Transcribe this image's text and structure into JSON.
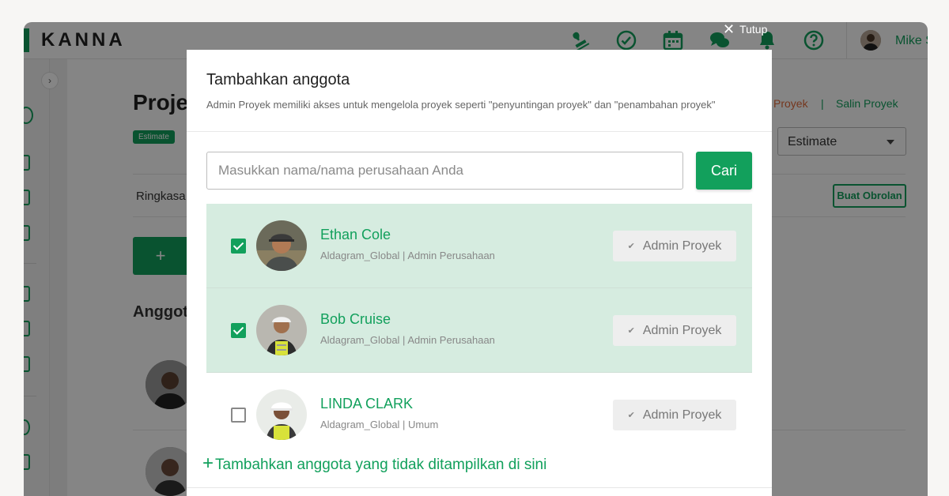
{
  "app": {
    "brand": "KANNA",
    "user_name": "Mike S"
  },
  "background": {
    "page_title": "Proje",
    "badge": "Estimate",
    "tab_label": "Ringkasa",
    "add_symbol": "+",
    "section_title": "Anggot",
    "link_project": "Proyek",
    "link_separator": "|",
    "link_copy": "Salin Proyek",
    "status_select_value": "Estimate",
    "chat_button": "Buat Obrolan"
  },
  "modal": {
    "close_label": "Tutup",
    "title": "Tambahkan anggota",
    "subtitle": "Admin Proyek memiliki akses untuk mengelola proyek seperti \"penyuntingan proyek\" dan \"penambahan proyek\"",
    "search": {
      "placeholder": "Masukkan nama/nama perusahaan Anda",
      "button": "Cari"
    },
    "members": [
      {
        "name": "Ethan Cole",
        "meta": "Aldagram_Global | Admin Perusahaan",
        "checked": true,
        "role": "Admin Proyek"
      },
      {
        "name": "Bob Cruise",
        "meta": "Aldagram_Global | Admin Perusahaan",
        "checked": true,
        "role": "Admin Proyek"
      },
      {
        "name": "LINDA CLARK",
        "meta": "Aldagram_Global | Umum",
        "checked": false,
        "role": "Admin Proyek"
      }
    ],
    "add_more_label": "Tambahkan anggota yang tidak ditampilkan di sini"
  },
  "icons": {
    "role_check": "✔",
    "close": "✕"
  },
  "colors": {
    "brand_green": "#12a05c",
    "selected_row": "#d6ece0",
    "accent_orange": "#e06a3a"
  }
}
